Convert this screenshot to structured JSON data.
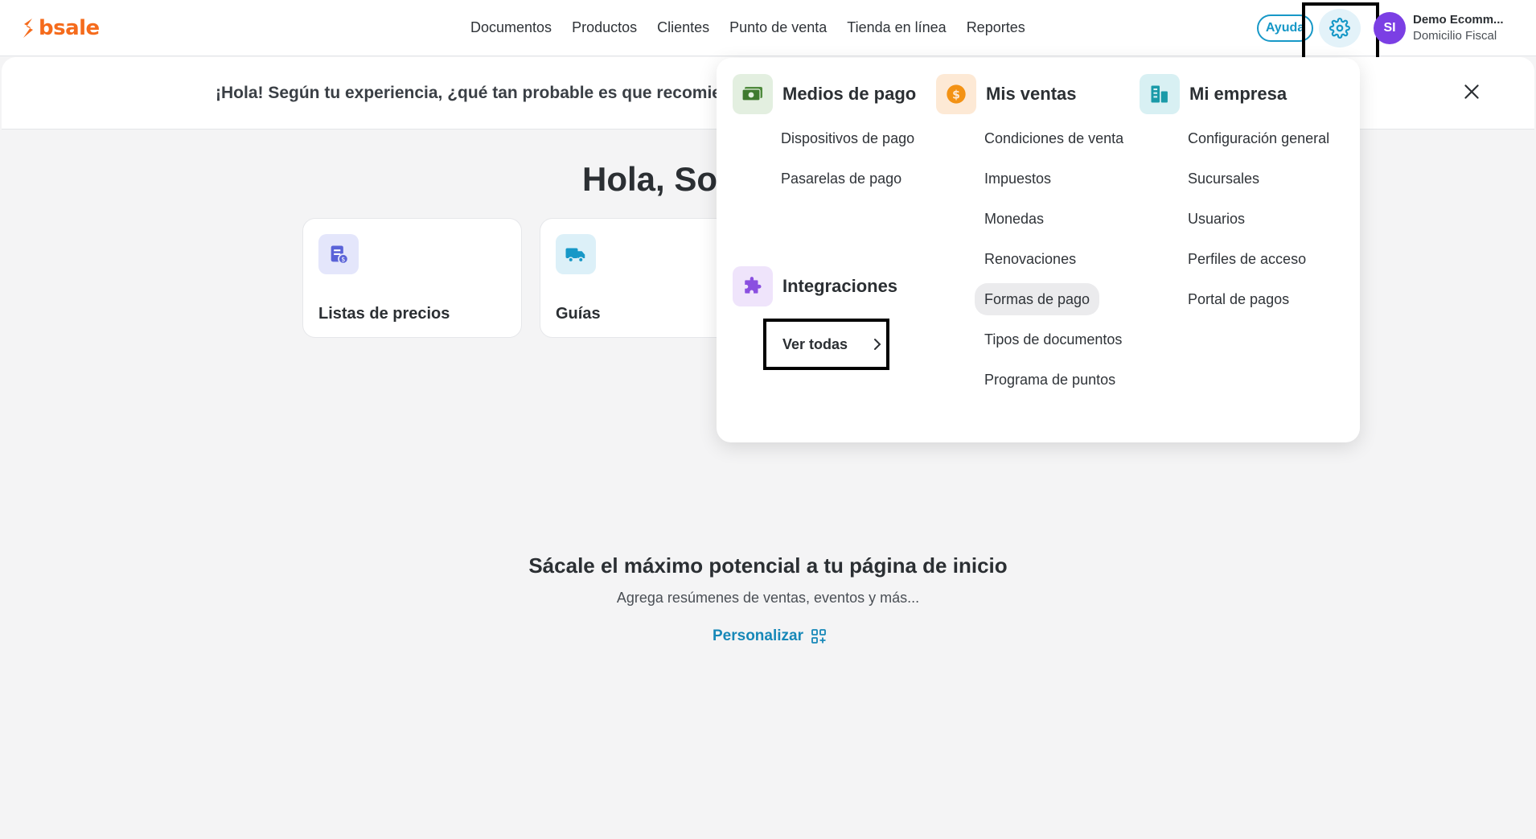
{
  "brand": {
    "name": "bsale",
    "color": "#f56b1c"
  },
  "nav": {
    "items": [
      {
        "label": "Documentos"
      },
      {
        "label": "Productos"
      },
      {
        "label": "Clientes"
      },
      {
        "label": "Punto de venta"
      },
      {
        "label": "Tienda en línea"
      },
      {
        "label": "Reportes"
      }
    ]
  },
  "header": {
    "help_label": "Ayuda",
    "settings_icon": "gear-icon",
    "avatar_initials": "SI",
    "account_name": "Demo Ecomm...",
    "account_sub": "Domicilio Fiscal"
  },
  "survey": {
    "text": "¡Hola! Según tu experiencia, ¿qué tan probable es que recomien"
  },
  "main": {
    "greeting": "Hola, Sop",
    "cards": [
      {
        "label": "Listas de precios",
        "icon": "price-list-icon"
      },
      {
        "label": "Guías",
        "icon": "truck-icon"
      }
    ],
    "promo_title": "Sácale el máximo potencial a tu página de inicio",
    "promo_sub": "Agrega resúmenes de ventas, eventos y más...",
    "promo_link": "Personalizar"
  },
  "menu": {
    "payments": {
      "title": "Medios de pago",
      "icon": "cash-icon",
      "items": [
        "Dispositivos de pago",
        "Pasarelas de pago"
      ]
    },
    "integrations": {
      "title": "Integraciones",
      "icon": "puzzle-icon",
      "see_all": "Ver todas"
    },
    "sales": {
      "title": "Mis ventas",
      "icon": "coin-icon",
      "items": [
        "Condiciones de venta",
        "Impuestos",
        "Monedas",
        "Renovaciones",
        "Formas de pago",
        "Tipos de documentos",
        "Programa de puntos"
      ],
      "active": "Formas de pago"
    },
    "company": {
      "title": "Mi empresa",
      "icon": "building-icon",
      "items": [
        "Configuración general",
        "Sucursales",
        "Usuarios",
        "Perfiles de acceso",
        "Portal de pagos"
      ]
    }
  },
  "colors": {
    "accent": "#1798c7",
    "avatar": "#7b3fe4",
    "payments_icon_bg": "#e3efe0",
    "sales_icon_bg": "#fde9d5",
    "company_icon_bg": "#d8f0f3",
    "integrations_icon_bg": "#efe4fb"
  }
}
